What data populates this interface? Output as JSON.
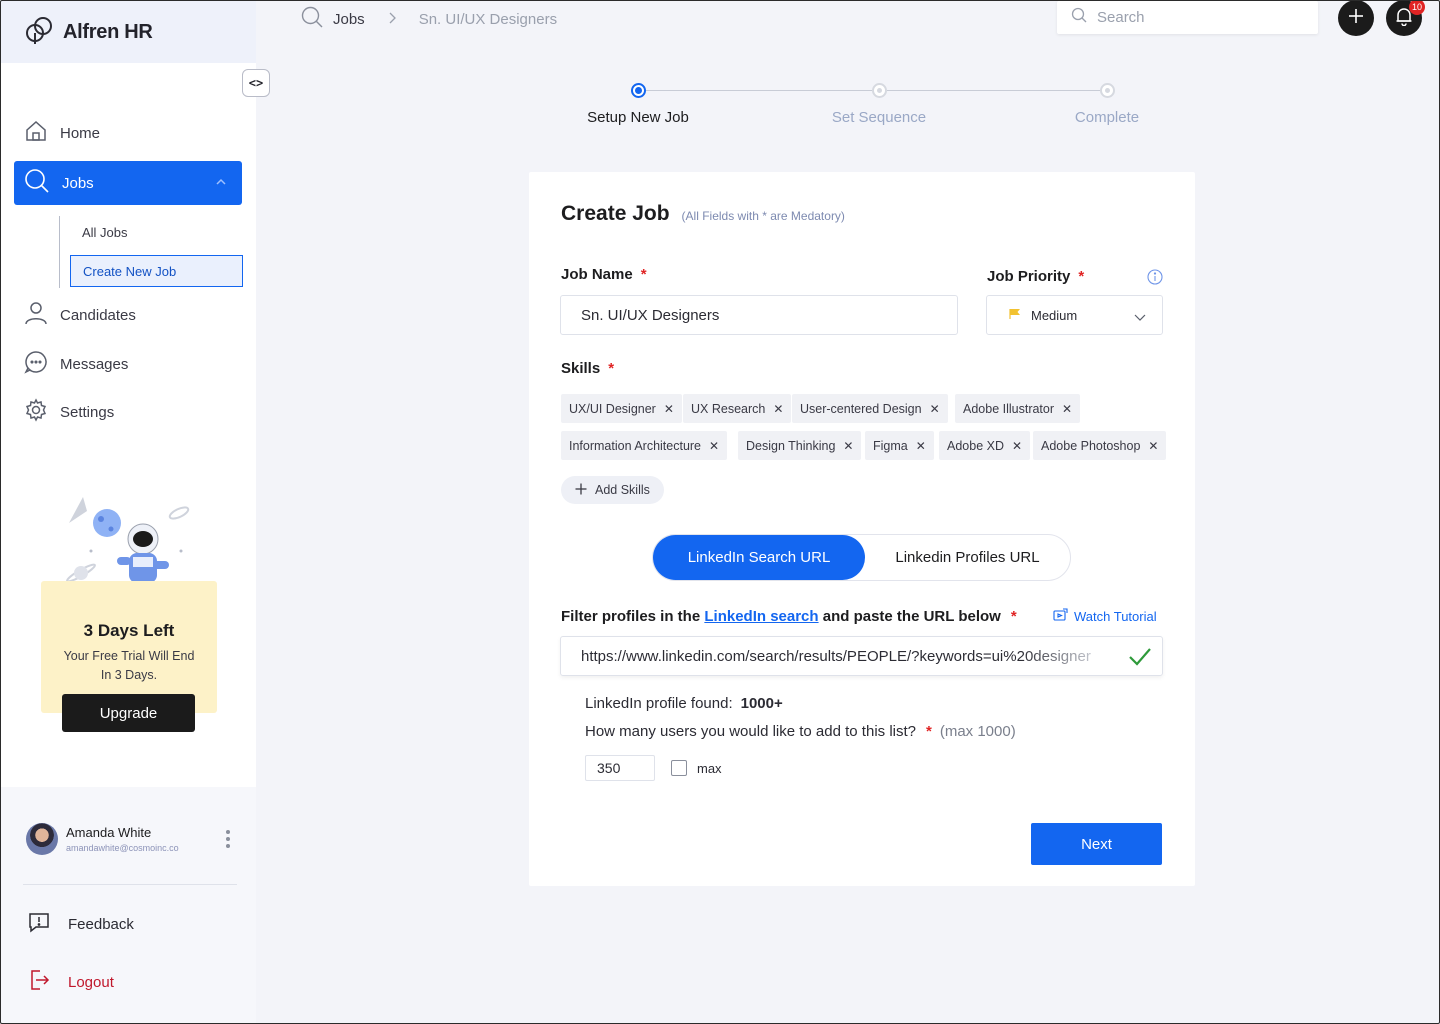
{
  "app": {
    "name": "Alfren HR",
    "collapse_label": "<>"
  },
  "nav": {
    "home": "Home",
    "jobs": "Jobs",
    "all_jobs": "All Jobs",
    "create_new_job": "Create New Job",
    "candidates": "Candidates",
    "messages": "Messages",
    "settings": "Settings"
  },
  "trial": {
    "title": "3 Days Left",
    "line1": "Your Free Trial Will End",
    "line2": "In 3 Days.",
    "button": "Upgrade"
  },
  "user": {
    "name": "Amanda White",
    "email": "amandawhite@cosmoinc.co"
  },
  "footer_links": {
    "feedback": "Feedback",
    "logout": "Logout"
  },
  "breadcrumb": {
    "root": "Jobs",
    "current": "Sn. UI/UX Designers"
  },
  "search": {
    "placeholder": "Search"
  },
  "notifications": {
    "count": "10"
  },
  "stepper": {
    "steps": [
      {
        "label": "Setup New Job",
        "active": true
      },
      {
        "label": "Set Sequence",
        "active": false
      },
      {
        "label": "Complete",
        "active": false
      }
    ]
  },
  "form": {
    "title": "Create Job",
    "subtitle": "(All Fields with * are Medatory)",
    "job_name_label": "Job Name",
    "job_name_value": "Sn. UI/UX Designers",
    "priority_label": "Job Priority",
    "priority_value": "Medium",
    "skills_label": "Skills",
    "skills": [
      "UX/UI Designer",
      "UX Research",
      "User-centered Design",
      "Adobe Illustrator",
      "Information Architecture",
      "Design Thinking",
      "Figma",
      "Adobe XD",
      "Adobe  Photoshop"
    ],
    "add_skills": "Add Skills",
    "url_toggle": {
      "active": "LinkedIn Search URL",
      "other": "Linkedin Profiles URL"
    },
    "filter_prefix": "Filter profiles in the",
    "filter_link": "LinkedIn search",
    "filter_suffix": "and paste the URL below",
    "watch_tutorial": "Watch Tutorial",
    "url_value": "https://www.linkedin.com/search/results/PEOPLE/?keywords=ui%20designer",
    "found_label": "LinkedIn profile found:",
    "found_value": "1000+",
    "howmany_label": "How many users you would like to add  to this list?",
    "howmany_max": "(max 1000)",
    "qty_value": "350",
    "max_label": "max",
    "next": "Next"
  },
  "colors": {
    "accent": "#1366f0",
    "dark": "#1b1b1b",
    "trial_bg": "#fdf2c8",
    "required": "#e02424",
    "success": "#2e9a3a",
    "logout": "#c0182c"
  }
}
